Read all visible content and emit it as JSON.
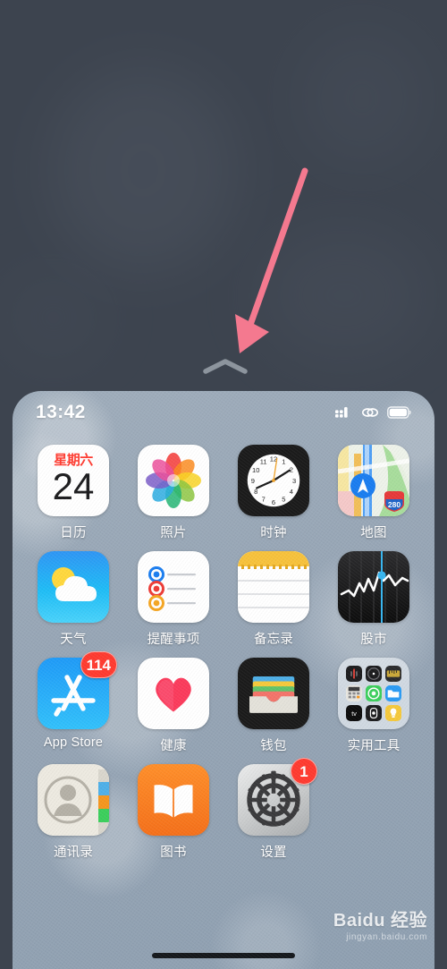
{
  "wallpaper": {
    "backdrop_color": "#3d444f",
    "panel_color": "#96a5b5"
  },
  "annotation": {
    "arrow_color": "#f4798f",
    "arrow_name": "swipe-up-arrow-annotation"
  },
  "handle": {
    "name": "swipe-up-chevron",
    "color": "#8d959e"
  },
  "status_bar": {
    "time": "13:42",
    "signal_icon": "cellular-signal-icon",
    "network_icon": "wifi-link-icon",
    "battery_icon": "battery-icon",
    "battery_level": 90
  },
  "home_screen": {
    "rows": [
      [
        {
          "name": "calendar",
          "label": "日历",
          "day_of_week": "星期六",
          "day": "24",
          "badge": null
        },
        {
          "name": "photos",
          "label": "照片",
          "badge": null
        },
        {
          "name": "clock",
          "label": "时钟",
          "badge": null
        },
        {
          "name": "maps",
          "label": "地图",
          "shield": "280",
          "badge": null
        }
      ],
      [
        {
          "name": "weather",
          "label": "天气",
          "badge": null
        },
        {
          "name": "reminders",
          "label": "提醒事项",
          "badge": null
        },
        {
          "name": "notes",
          "label": "备忘录",
          "badge": null
        },
        {
          "name": "stocks",
          "label": "股市",
          "badge": null
        }
      ],
      [
        {
          "name": "app-store",
          "label": "App Store",
          "badge": "114"
        },
        {
          "name": "health",
          "label": "健康",
          "badge": null
        },
        {
          "name": "wallet",
          "label": "钱包",
          "badge": null
        },
        {
          "name": "utilities-folder",
          "label": "实用工具",
          "badge": null
        }
      ],
      [
        {
          "name": "contacts",
          "label": "通讯录",
          "badge": null
        },
        {
          "name": "books",
          "label": "图书",
          "badge": null
        },
        {
          "name": "settings",
          "label": "设置",
          "badge": "1"
        }
      ]
    ],
    "folder_mini_icons": [
      "voice-memos-icon",
      "compass-icon",
      "measure-icon",
      "calculator-icon",
      "find-my-icon",
      "files-icon",
      "apple-tv-icon",
      "watch-icon",
      "flashlight-icon"
    ]
  },
  "home_indicator": {
    "name": "home-indicator"
  },
  "watermark": {
    "main": "Baidu 经验",
    "sub": "jingyan.baidu.com"
  }
}
